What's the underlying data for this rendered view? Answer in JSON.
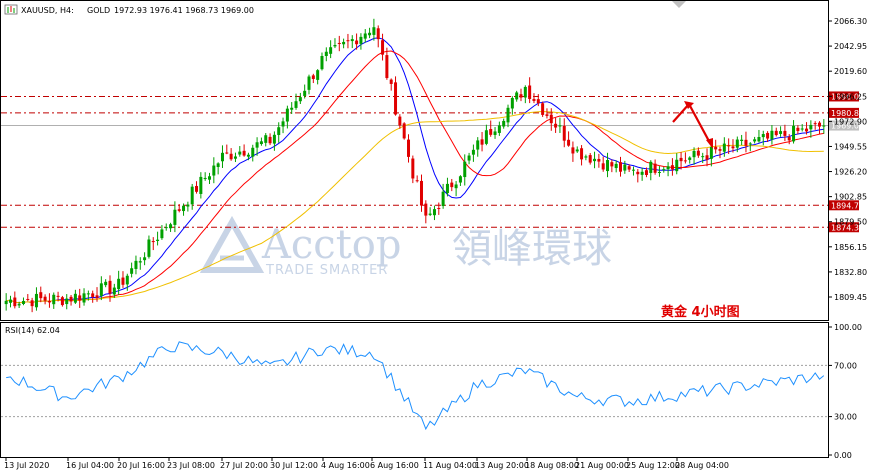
{
  "header": {
    "symbol": "XAUUSD, H4:",
    "name": "GOLD",
    "ohlc": "1972.93 1976.41 1968.73 1969.00"
  },
  "price_panel": {
    "y_ticks": [
      "2066.30",
      "2042.95",
      "2019.60",
      "1996.25",
      "1972.90",
      "1949.55",
      "1926.20",
      "1902.85",
      "1879.50",
      "1856.15",
      "1832.80",
      "1809.45"
    ],
    "current_price": "1969.00"
  },
  "horizontal_lines": [
    {
      "label": "1996.08",
      "value": 1996.08,
      "color": "#c00000"
    },
    {
      "label": "1980.80",
      "value": 1980.8,
      "color": "#c00000"
    },
    {
      "label": "1894.79",
      "value": 1894.79,
      "color": "#c00000"
    },
    {
      "label": "1874.36",
      "value": 1874.36,
      "color": "#c00000"
    }
  ],
  "rsi_panel": {
    "label": "RSI(14) 62.04",
    "y_ticks": [
      "100.00",
      "70.00",
      "30.00",
      "0.00"
    ],
    "levels": [
      70,
      30
    ]
  },
  "x_ticks": [
    "13 Jul 2020",
    "16 Jul 04:00",
    "20 Jul 16:00",
    "23 Jul 08:00",
    "27 Jul 20:00",
    "30 Jul 12:00",
    "4 Aug 16:00",
    "6 Aug 16:00",
    "11 Aug 04:00",
    "13 Aug 20:00",
    "18 Aug 08:00",
    "21 Aug 00:00",
    "25 Aug 12:00",
    "28 Aug 04:00"
  ],
  "watermark": {
    "brand": "Acctop",
    "chinese": "領峰環球",
    "tagline": "TRADE SMARTER"
  },
  "annotation": "黄金 4小时图",
  "colors": {
    "bull": "#00a000",
    "bear": "#e00000",
    "ma_fast": "#0000ff",
    "ma_mid": "#ff0000",
    "ma_slow": "#f0c000",
    "rsi": "#1e90ff",
    "arrow": "#e00000"
  },
  "chart_data": {
    "type": "candlestick",
    "ylim": [
      1800,
      2075
    ],
    "close_path": [
      {
        "x": "13 Jul 2020",
        "y": 1806
      },
      {
        "x": "16 Jul 04:00",
        "y": 1808
      },
      {
        "x": "20 Jul 16:00",
        "y": 1820
      },
      {
        "x": "23 Jul 08:00",
        "y": 1882
      },
      {
        "x": "27 Jul 20:00",
        "y": 1940
      },
      {
        "x": "30 Jul 12:00",
        "y": 1955
      },
      {
        "x": "4 Aug 16:00",
        "y": 2030
      },
      {
        "x": "6 Aug 16:00",
        "y": 2062
      },
      {
        "x": "11 Aug 04:00",
        "y": 1880
      },
      {
        "x": "13 Aug 20:00",
        "y": 1950
      },
      {
        "x": "18 Aug 08:00",
        "y": 2005
      },
      {
        "x": "21 Aug 00:00",
        "y": 1945
      },
      {
        "x": "25 Aug 12:00",
        "y": 1925
      },
      {
        "x": "28 Aug 04:00",
        "y": 1969
      }
    ],
    "rsi": {
      "ylim": [
        0,
        100
      ],
      "path": [
        {
          "x": "13 Jul 2020",
          "y": 62
        },
        {
          "x": "16 Jul 04:00",
          "y": 45
        },
        {
          "x": "20 Jul 16:00",
          "y": 60
        },
        {
          "x": "23 Jul 08:00",
          "y": 85
        },
        {
          "x": "27 Jul 20:00",
          "y": 80
        },
        {
          "x": "30 Jul 12:00",
          "y": 68
        },
        {
          "x": "4 Aug 16:00",
          "y": 83
        },
        {
          "x": "6 Aug 16:00",
          "y": 80
        },
        {
          "x": "11 Aug 04:00",
          "y": 20
        },
        {
          "x": "13 Aug 20:00",
          "y": 55
        },
        {
          "x": "18 Aug 08:00",
          "y": 66
        },
        {
          "x": "21 Aug 00:00",
          "y": 45
        },
        {
          "x": "25 Aug 12:00",
          "y": 42
        },
        {
          "x": "28 Aug 04:00",
          "y": 62
        }
      ]
    }
  }
}
